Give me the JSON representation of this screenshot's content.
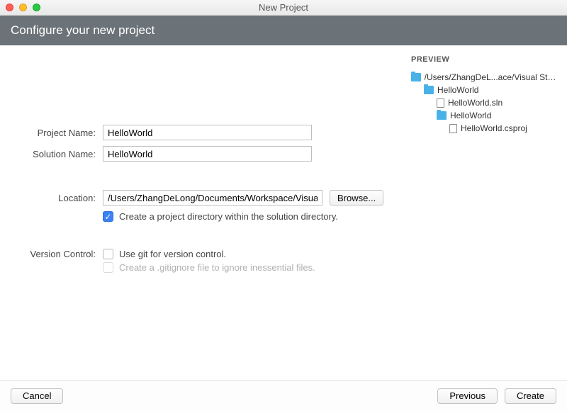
{
  "window": {
    "title": "New Project"
  },
  "header": {
    "title": "Configure your new project"
  },
  "form": {
    "project_name_label": "Project Name:",
    "project_name_value": "HelloWorld",
    "solution_name_label": "Solution Name:",
    "solution_name_value": "HelloWorld",
    "location_label": "Location:",
    "location_value": "/Users/ZhangDeLong/Documents/Workspace/Visual Studio",
    "browse_label": "Browse...",
    "create_dir_label": "Create a project directory within the solution directory.",
    "create_dir_checked": true,
    "version_control_label": "Version Control:",
    "use_git_label": "Use git for version control.",
    "use_git_checked": false,
    "gitignore_label": "Create a .gitignore file to ignore inessential files."
  },
  "preview": {
    "title": "PREVIEW",
    "items": [
      {
        "level": 0,
        "type": "folder",
        "label": "/Users/ZhangDeL...ace/Visual Studio"
      },
      {
        "level": 1,
        "type": "folder",
        "label": "HelloWorld"
      },
      {
        "level": 2,
        "type": "file",
        "label": "HelloWorld.sln"
      },
      {
        "level": 2,
        "type": "folder",
        "label": "HelloWorld"
      },
      {
        "level": 3,
        "type": "file",
        "label": "HelloWorld.csproj"
      }
    ]
  },
  "footer": {
    "cancel_label": "Cancel",
    "previous_label": "Previous",
    "create_label": "Create"
  }
}
